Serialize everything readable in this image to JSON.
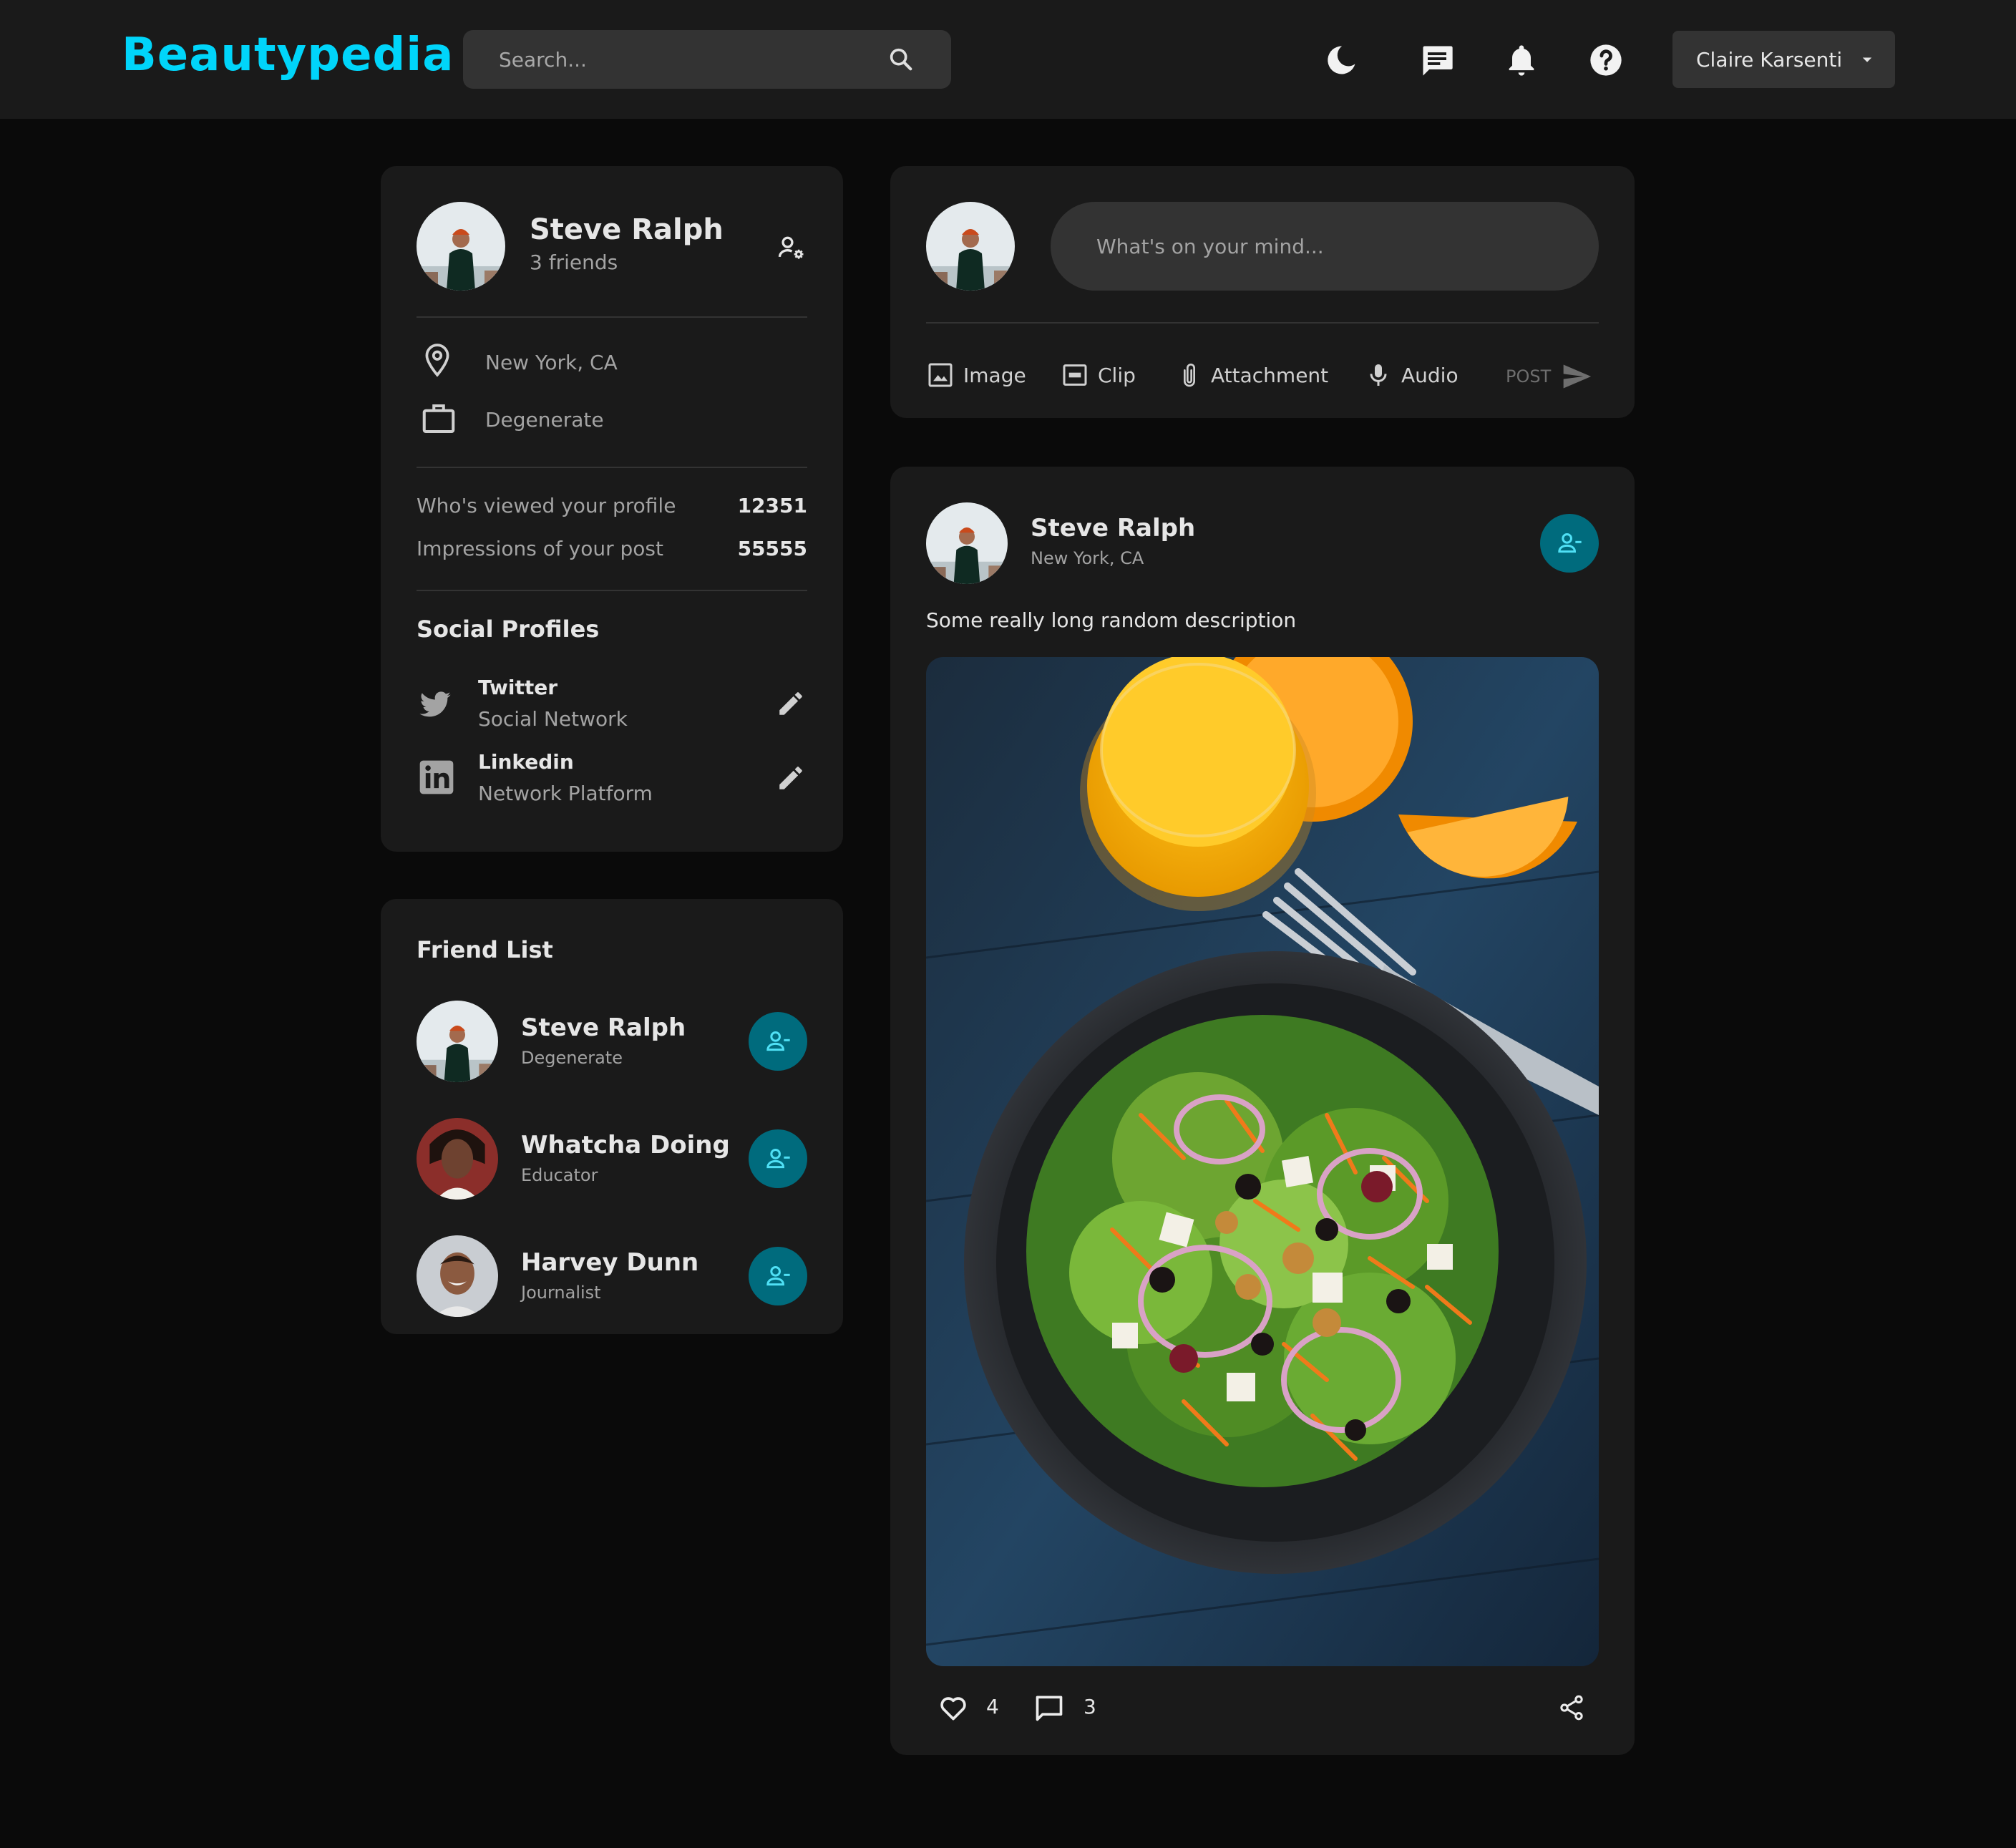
{
  "brand": "Beautypedia",
  "search": {
    "placeholder": "Search..."
  },
  "nav": {
    "icons": [
      "dark-mode-icon",
      "message-icon",
      "notification-icon",
      "help-icon"
    ],
    "user_name": "Claire Karsenti"
  },
  "profile": {
    "name": "Steve Ralph",
    "friends": "3 friends",
    "location": "New York, CA",
    "occupation": "Degenerate",
    "stats": [
      {
        "label": "Who's viewed your profile",
        "value": "12351"
      },
      {
        "label": "Impressions of your post",
        "value": "55555"
      }
    ],
    "social_title": "Social Profiles",
    "socials": [
      {
        "name": "Twitter",
        "type": "Social Network"
      },
      {
        "name": "Linkedin",
        "type": "Network Platform"
      }
    ]
  },
  "friend_list": {
    "title": "Friend List",
    "friends": [
      {
        "name": "Steve Ralph",
        "occupation": "Degenerate"
      },
      {
        "name": "Whatcha Doing",
        "occupation": "Educator"
      },
      {
        "name": "Harvey Dunn",
        "occupation": "Journalist"
      }
    ]
  },
  "composer": {
    "placeholder": "What's on your mind...",
    "actions": [
      "Image",
      "Clip",
      "Attachment",
      "Audio"
    ],
    "post_label": "POST"
  },
  "post": {
    "author": "Steve Ralph",
    "location": "New York, CA",
    "description": "Some really long random description",
    "likes": "4",
    "comments": "3"
  },
  "colors": {
    "accent": "#00d5fa",
    "teal": "#006b7d",
    "card": "#1a1a1a",
    "background": "#0a0a0a"
  }
}
